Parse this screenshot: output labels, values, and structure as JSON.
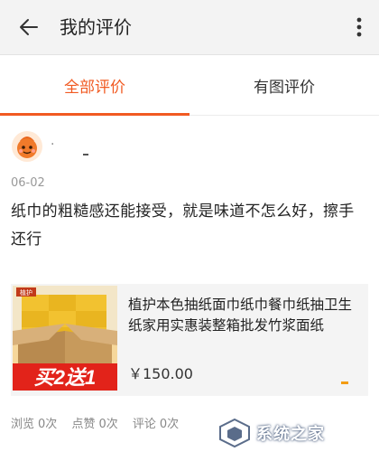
{
  "header": {
    "title": "我的评价",
    "back_icon": "back-arrow-icon",
    "more_icon": "more-vertical-icon"
  },
  "tabs": [
    {
      "label": "全部评价",
      "active": true
    },
    {
      "label": "有图评价",
      "active": false
    }
  ],
  "review": {
    "username": "·",
    "date": "06-02",
    "text": "纸巾的粗糙感还能接受，就是味道不怎么好，擦手还行",
    "product": {
      "name": "植护本色抽纸面巾纸巾餐巾纸抽卫生纸家用实惠装整箱批发竹浆面纸",
      "price": "￥150.00",
      "badge_top": "植护",
      "promo_text": "买2送1"
    }
  },
  "stats": {
    "views_label": "浏览",
    "views_value": "0次",
    "likes_label": "点赞",
    "likes_value": "0次",
    "comments_label": "评论",
    "comments_value": "0次"
  },
  "watermark": {
    "text": "系统之家"
  },
  "colors": {
    "accent": "#f15a22",
    "header_bg": "#f3f3f3",
    "product_bg": "#f4f4f4"
  }
}
